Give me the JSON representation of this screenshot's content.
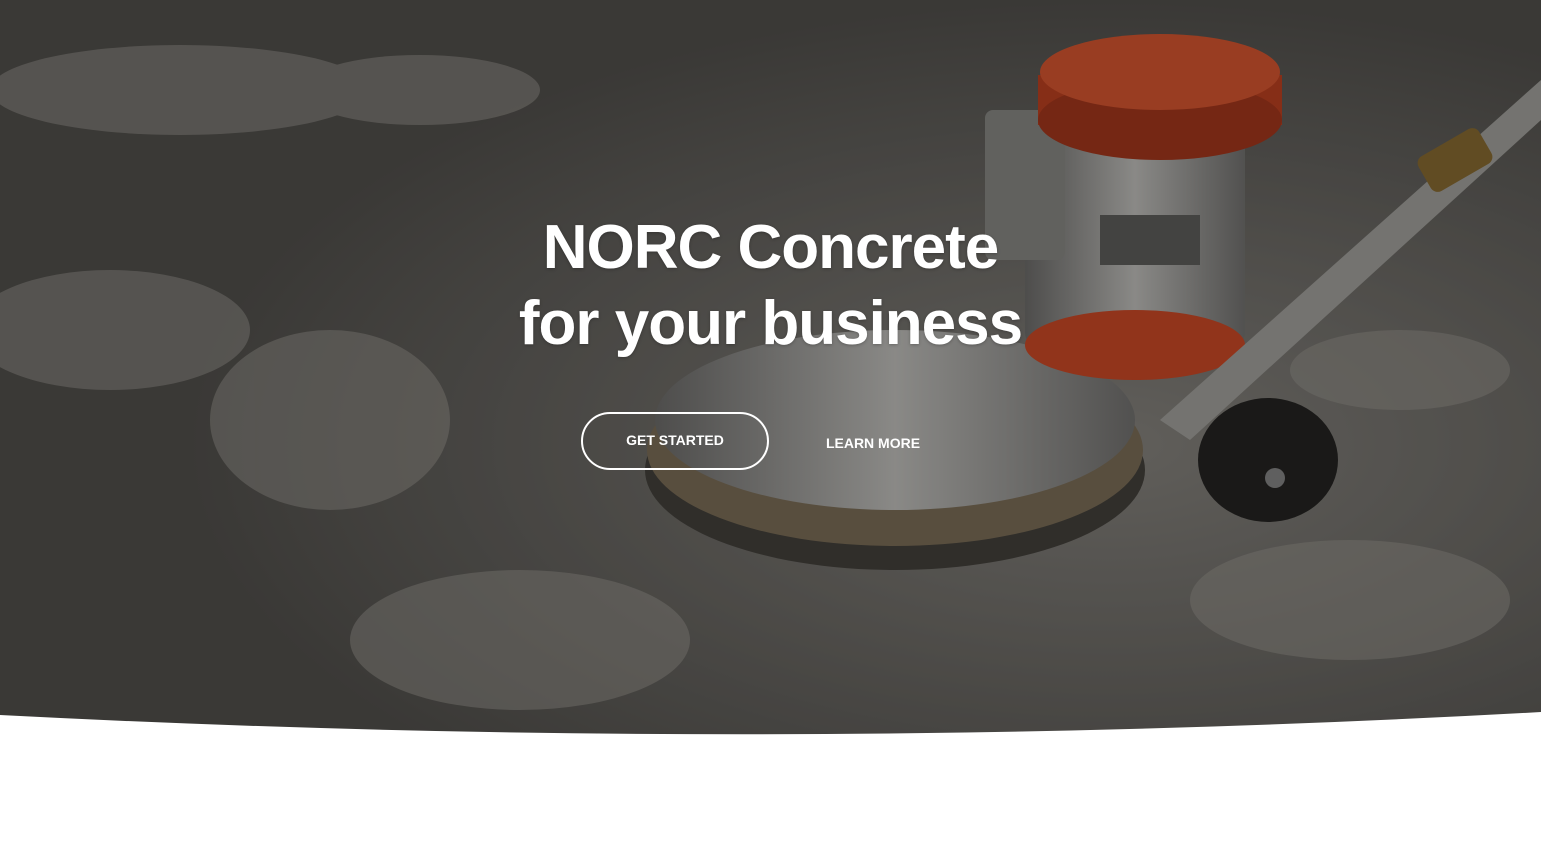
{
  "hero": {
    "headline_line1": "NORC Concrete",
    "headline_line2": "for your business",
    "primary_cta": "GET STARTED",
    "secondary_cta": "LEARN MORE",
    "image": "floor-grinder-photo"
  },
  "colors": {
    "text": "#ffffff",
    "overlay": "#2a2926",
    "page_background": "#ffffff",
    "machine_accent": "#d4451f"
  }
}
